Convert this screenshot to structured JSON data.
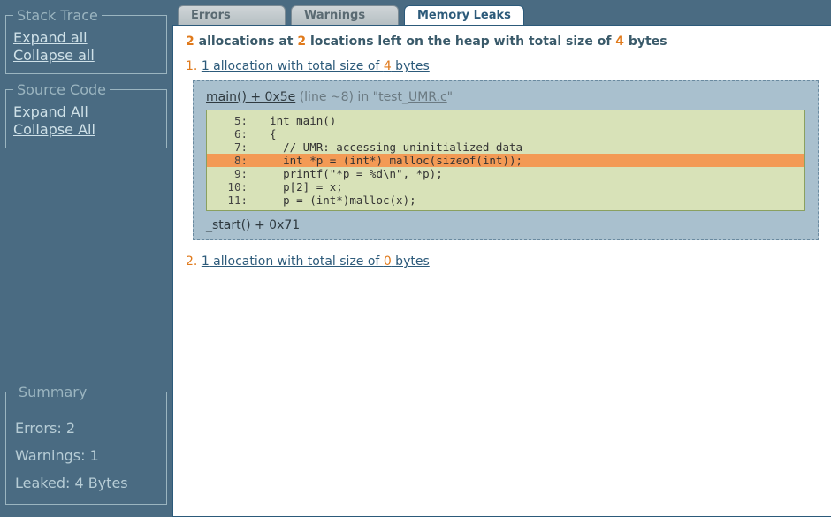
{
  "sidebar": {
    "stack_trace": {
      "legend": "Stack Trace",
      "expand": "Expand all",
      "collapse": "Collapse all"
    },
    "source_code": {
      "legend": "Source Code",
      "expand": "Expand All",
      "collapse": "Collapse All"
    },
    "summary": {
      "legend": "Summary",
      "errors": "Errors: 2",
      "warnings": "Warnings: 1",
      "leaked": "Leaked: 4 Bytes"
    }
  },
  "tabs": {
    "errors": "Errors",
    "warnings": "Warnings",
    "memory_leaks": "Memory Leaks"
  },
  "heading": {
    "n_alloc": "2",
    "t1": " allocations at ",
    "n_loc": "2",
    "t2": " locations left on the heap with total size of ",
    "n_bytes": "4",
    "t3": " bytes"
  },
  "alloc1": {
    "idx": "1. ",
    "n": "1",
    "mid": " allocation with total size of ",
    "bytes": "4",
    "tail": " bytes",
    "frame": {
      "fn": "main() + 0x5e",
      "grey": " (line ~8) in \"test_",
      "file": "UMR.c",
      "close": "\""
    },
    "code": [
      {
        "n": "5:",
        "t": "int main()"
      },
      {
        "n": "6:",
        "t": "{"
      },
      {
        "n": "7:",
        "t": "  // UMR: accessing uninitialized data"
      },
      {
        "n": "8:",
        "t": "  int *p = (int*) malloc(sizeof(int));",
        "hl": true
      },
      {
        "n": "9:",
        "t": "  printf(\"*p = %d\\n\", *p);"
      },
      {
        "n": "10:",
        "t": "  p[2] = x;"
      },
      {
        "n": "11:",
        "t": "  p = (int*)malloc(x);"
      }
    ],
    "frame2": "_start() + 0x71"
  },
  "alloc2": {
    "idx": "2. ",
    "n": "1",
    "mid": " allocation with total size of ",
    "bytes": "0",
    "tail": " bytes"
  }
}
